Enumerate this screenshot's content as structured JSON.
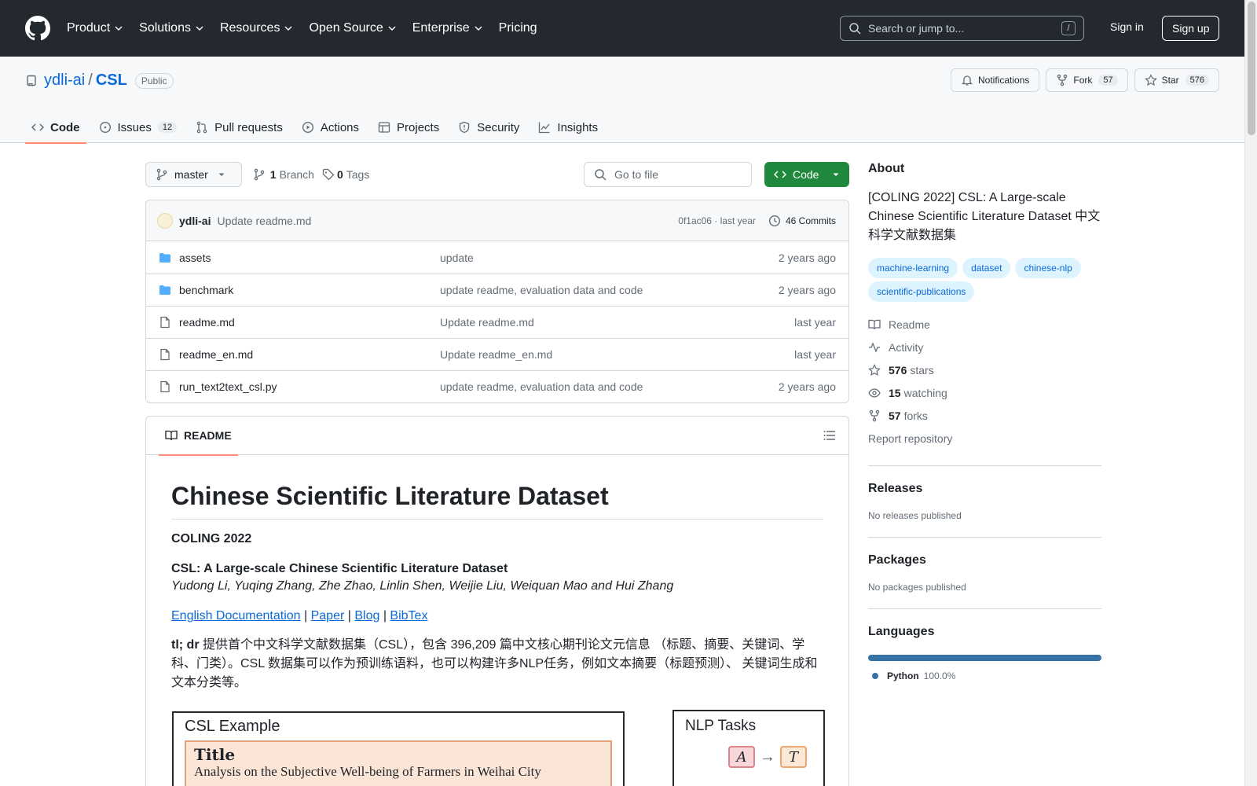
{
  "header": {
    "nav": [
      "Product",
      "Solutions",
      "Resources",
      "Open Source",
      "Enterprise",
      "Pricing"
    ],
    "search_placeholder": "Search or jump to...",
    "search_key": "/",
    "signin": "Sign in",
    "signup": "Sign up"
  },
  "repo": {
    "owner": "ydli-ai",
    "separator": "/",
    "name": "CSL",
    "visibility": "Public",
    "notifications_label": "Notifications",
    "fork_label": "Fork",
    "fork_count": "57",
    "star_label": "Star",
    "star_count": "576"
  },
  "tabs": [
    {
      "label": "Code",
      "count": "",
      "icon": "code-icon"
    },
    {
      "label": "Issues",
      "count": "12",
      "icon": "issue-icon"
    },
    {
      "label": "Pull requests",
      "count": "",
      "icon": "pull-request-icon"
    },
    {
      "label": "Actions",
      "count": "",
      "icon": "play-icon"
    },
    {
      "label": "Projects",
      "count": "",
      "icon": "table-icon"
    },
    {
      "label": "Security",
      "count": "",
      "icon": "shield-icon"
    },
    {
      "label": "Insights",
      "count": "",
      "icon": "graph-icon"
    }
  ],
  "toolbar": {
    "branch": "master",
    "branches_count": "1",
    "branches_label": "Branch",
    "tags_count": "0",
    "tags_label": "Tags",
    "goto_placeholder": "Go to file",
    "code_button": "Code"
  },
  "commit": {
    "author": "ydli-ai",
    "message": "Update readme.md",
    "hash_time": "0f1ac06 · last year",
    "count_label": "46 Commits"
  },
  "files": [
    {
      "type": "dir",
      "name": "assets",
      "commit": "update",
      "age": "2 years ago"
    },
    {
      "type": "dir",
      "name": "benchmark",
      "commit": "update readme, evaluation data and code",
      "age": "2 years ago"
    },
    {
      "type": "file",
      "name": "readme.md",
      "commit": "Update readme.md",
      "age": "last year"
    },
    {
      "type": "file",
      "name": "readme_en.md",
      "commit": "Update readme_en.md",
      "age": "last year"
    },
    {
      "type": "file",
      "name": "run_text2text_csl.py",
      "commit": "update readme, evaluation data and code",
      "age": "2 years ago"
    }
  ],
  "readme": {
    "tab_label": "README",
    "h1": "Chinese Scientific Literature Dataset",
    "conference": "COLING 2022",
    "paper_title": "CSL: A Large-scale Chinese Scientific Literature Dataset",
    "authors": "Yudong Li, Yuqing Zhang, Zhe Zhao, Linlin Shen, Weijie Liu, Weiquan Mao and Hui Zhang",
    "links": [
      "English Documentation",
      "Paper",
      "Blog",
      "BibTex"
    ],
    "link_separator": " | ",
    "tldr_label": "tl; dr",
    "tldr_text": " 提供首个中文科学文献数据集（CSL），包含 396,209 篇中文核心期刊论文元信息 （标题、摘要、关键词、学科、门类）。CSL 数据集可以作为预训练语料，也可以构建许多NLP任务，例如文本摘要（标题预测）、 关键词生成和文本分类等。",
    "fig1_title": "CSL Example",
    "fig1_box_title": "Title",
    "fig1_box_text": "Analysis on the Subjective Well-being of Farmers in Weihai City",
    "fig2_title": "NLP Tasks",
    "fig2_node_a": "A",
    "fig2_node_t": "T"
  },
  "sidebar": {
    "about_title": "About",
    "description": "[COLING 2022] CSL: A Large-scale Chinese Scientific Literature Dataset 中文科学文献数据集",
    "topics": [
      "machine-learning",
      "dataset",
      "chinese-nlp",
      "scientific-publications"
    ],
    "readme": "Readme",
    "activity": "Activity",
    "stars_count": "576",
    "stars_label": "stars",
    "watching_count": "15",
    "watching_label": "watching",
    "forks_count": "57",
    "forks_label": "forks",
    "report": "Report repository",
    "releases_title": "Releases",
    "releases_text": "No releases published",
    "packages_title": "Packages",
    "packages_text": "No packages published",
    "languages_title": "Languages",
    "language_name": "Python",
    "language_pct": "100.0%",
    "language_fraction": 1.0,
    "language_color": "#3572a5"
  },
  "colors": {
    "header_bg": "#24292f",
    "accent": "#0969da",
    "primary_button": "#1f883d",
    "tab_underline": "#fd8c73"
  }
}
